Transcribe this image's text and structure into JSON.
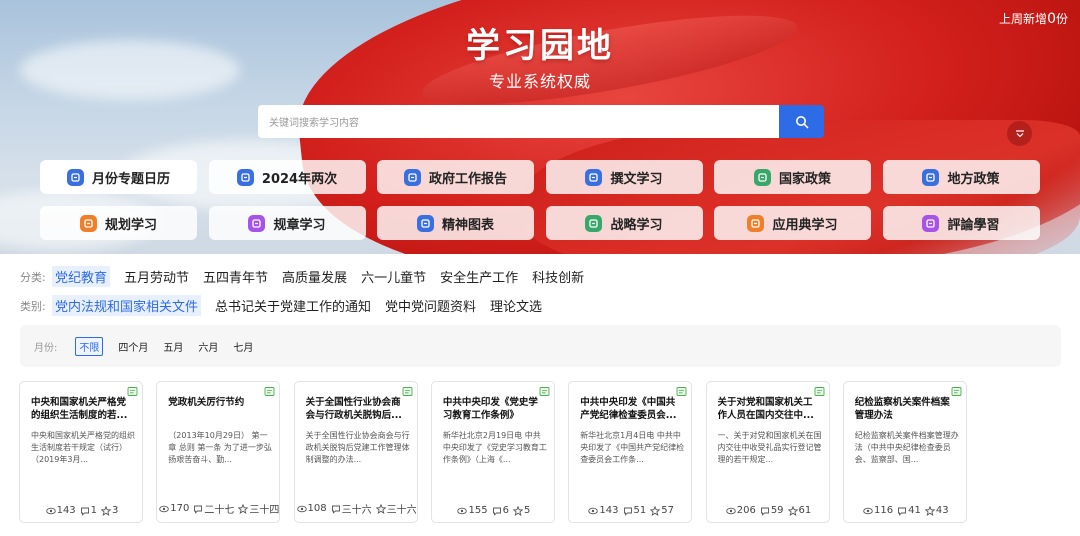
{
  "header": {
    "title": "学习园地",
    "subtitle": "专业系统权威",
    "weekly_prefix": "上周新增",
    "weekly_count": "0",
    "weekly_suffix": "份"
  },
  "search": {
    "placeholder": "关键词搜索学习内容"
  },
  "tiles": [
    {
      "label": "月份专题日历",
      "icon": "calendar-icon",
      "color": "#3a6fe0"
    },
    {
      "label": "2024年两次",
      "icon": "book-icon",
      "color": "#3a6fe0"
    },
    {
      "label": "政府工作报告",
      "icon": "report-icon",
      "color": "#3a6fe0"
    },
    {
      "label": "撰文学习",
      "icon": "pen-icon",
      "color": "#3a6fe0"
    },
    {
      "label": "国家政策",
      "icon": "policy-icon",
      "color": "#37a86a"
    },
    {
      "label": "地方政策",
      "icon": "local-policy-icon",
      "color": "#3a6fe0"
    },
    {
      "label": "规划学习",
      "icon": "plan-icon",
      "color": "#f07f2c"
    },
    {
      "label": "规章学习",
      "icon": "rules-icon",
      "color": "#a653e8"
    },
    {
      "label": "精神图表",
      "icon": "chart-icon",
      "color": "#3a6fe0"
    },
    {
      "label": "战略学习",
      "icon": "strategy-icon",
      "color": "#37a86a"
    },
    {
      "label": "应用典学习",
      "icon": "classic-icon",
      "color": "#f07f2c"
    },
    {
      "label": "評論學習",
      "icon": "comment-icon",
      "color": "#a653e8"
    }
  ],
  "filters": {
    "category_label": "分类:",
    "categories": [
      "党纪教育",
      "五月劳动节",
      "五四青年节",
      "高质量发展",
      "六一儿童节",
      "安全生产工作",
      "科技创新"
    ],
    "type_label": "类别:",
    "types": [
      "党内法规和国家相关文件",
      "总书记关于党建工作的通知",
      "党中党问题资料",
      "理论文选"
    ],
    "month_label": "月份:",
    "months": [
      "不限",
      "四个月",
      "五月",
      "六月",
      "七月"
    ]
  },
  "cards": [
    {
      "title": "中央和国家机关严格党的组织生活制度的若...",
      "desc": "中央和国家机关严格党的组织生活制度若干规定（试行）（2019年3月...",
      "views": "143",
      "comments": "1",
      "stars": "3"
    },
    {
      "title": "党政机关厉行节约",
      "desc": "（2013年10月29日） 第一章 总则 第一条 为了进一步弘扬艰苦奋斗、勤...",
      "views": "170",
      "comments": "二十七",
      "stars": "三十四"
    },
    {
      "title": "关于全国性行业协会商会与行政机关脱钩后...",
      "desc": "关于全国性行业协会商会与行政机关脱钩后党建工作管理体制调整的办法...",
      "views": "108",
      "comments": "三十六",
      "stars": "三十六"
    },
    {
      "title": "中共中央印发《党史学习教育工作条例》",
      "desc": "新华社北京2月19日电 中共中央印发了《党史学习教育工作条例》（上海《...",
      "views": "155",
      "comments": "6",
      "stars": "5"
    },
    {
      "title": "中共中央印发《中国共产党纪律检查委员会...",
      "desc": "新华社北京1月4日电 中共中央印发了《中国共产党纪律检查委员会工作条...",
      "views": "143",
      "comments": "51",
      "stars": "57"
    },
    {
      "title": "关于对党和国家机关工作人员在国内交往中...",
      "desc": "一、关于对党和国家机关在国内交往中收受礼品实行登记管理的若干规定...",
      "views": "206",
      "comments": "59",
      "stars": "61"
    },
    {
      "title": "纪检监察机关案件档案管理办法",
      "desc": "纪检监察机关案件档案管理办法（中共中央纪律检查委员会、监察部、国...",
      "views": "116",
      "comments": "41",
      "stars": "43"
    }
  ],
  "colors": {
    "accent": "#2e6be6",
    "flag_red": "#d3201c"
  }
}
